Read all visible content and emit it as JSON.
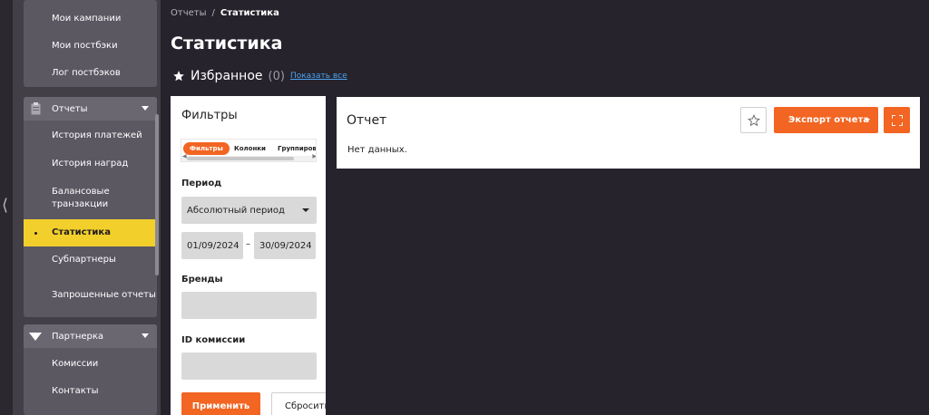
{
  "sidebar": {
    "group1": [
      {
        "label": "Мои кампании"
      },
      {
        "label": "Мои постбэки"
      },
      {
        "label": "Лог постбэков"
      }
    ],
    "reports_header": "Отчеты",
    "reports_items": [
      {
        "label": "История платежей"
      },
      {
        "label": "История наград"
      },
      {
        "label": "Балансовые транзакции"
      },
      {
        "label": "Статистика"
      },
      {
        "label": "Субпартнеры"
      },
      {
        "label": "Запрошенные отчеты"
      }
    ],
    "partner_header": "Партнерка",
    "partner_items": [
      {
        "label": "Комиссии"
      },
      {
        "label": "Контакты"
      }
    ]
  },
  "breadcrumb": {
    "parent": "Отчеты",
    "separator": "/",
    "current": "Статистика"
  },
  "page": {
    "title": "Статистика"
  },
  "favorites": {
    "label": "Избранное",
    "count": "(0)",
    "show_all": "Показать все"
  },
  "filters": {
    "title": "Фильтры",
    "tabs": [
      "Фильтры",
      "Колонки",
      "Группировать"
    ],
    "period_label": "Период",
    "period_value": "Абсолютный период",
    "date_from": "01/09/2024",
    "date_sep": "–",
    "date_to": "30/09/2024",
    "brands_label": "Бренды",
    "commission_label": "ID комиссии",
    "apply": "Применить",
    "reset": "Сбросить"
  },
  "report": {
    "title": "Отчет",
    "export": "Экспорт отчета",
    "empty": "Нет данных."
  },
  "colors": {
    "accent": "#f26522",
    "active_nav": "#f3cf2c",
    "background": "#26232c",
    "link": "#4aa3f0"
  }
}
